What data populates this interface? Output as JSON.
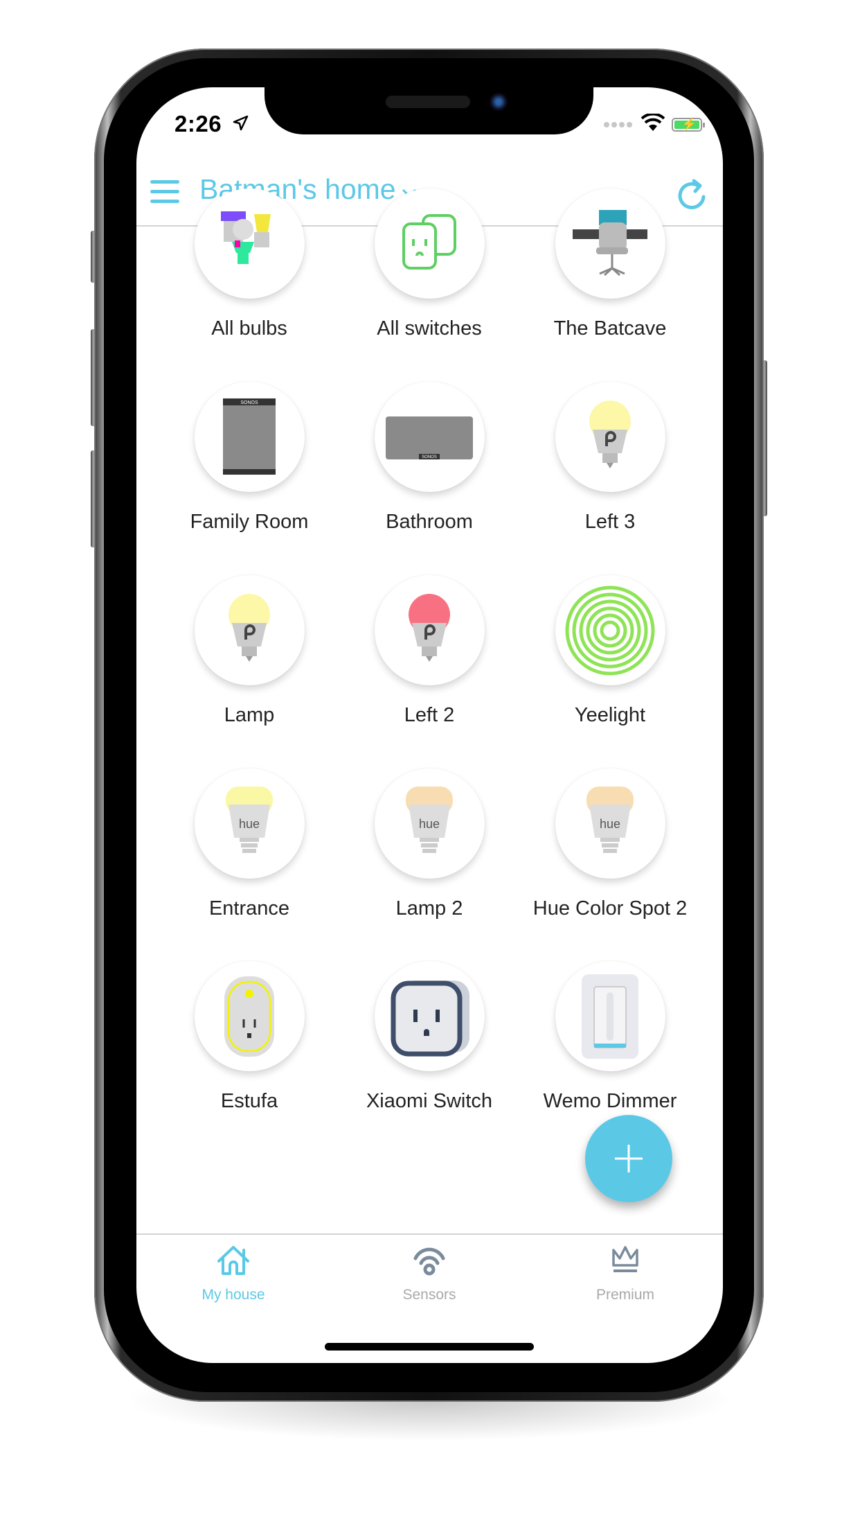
{
  "status_bar": {
    "time": "2:26",
    "location_icon": "location-arrow-icon",
    "battery_charging": true
  },
  "header": {
    "title": "Batman's home",
    "menu_icon": "hamburger-icon",
    "refresh_icon": "refresh-icon"
  },
  "colors": {
    "accent": "#5bc9e6",
    "inactive": "#7a8b9c",
    "label": "#222222"
  },
  "devices": [
    {
      "label": "All bulbs",
      "icon": "bulbs-group"
    },
    {
      "label": "All switches",
      "icon": "switches-group"
    },
    {
      "label": "The Batcave",
      "icon": "office-chair"
    },
    {
      "label": "Family Room",
      "icon": "sonos-tall"
    },
    {
      "label": "Bathroom",
      "icon": "sonos-wide"
    },
    {
      "label": "Left 3",
      "icon": "tplink-bulb",
      "color": "#fdf7a8"
    },
    {
      "label": "Lamp",
      "icon": "tplink-bulb",
      "color": "#fdf7a8"
    },
    {
      "label": "Left 2",
      "icon": "tplink-bulb",
      "color": "#f87182"
    },
    {
      "label": "Yeelight",
      "icon": "light-strip",
      "color": "#8fe356"
    },
    {
      "label": "Entrance",
      "icon": "hue-bulb",
      "color": "#fbf8a5"
    },
    {
      "label": "Lamp 2",
      "icon": "hue-bulb",
      "color": "#f9ddb2"
    },
    {
      "label": "Hue Color Spot 2",
      "icon": "hue-bulb",
      "color": "#f9ddb2"
    },
    {
      "label": "Estufa",
      "icon": "tplink-plug"
    },
    {
      "label": "Xiaomi Switch",
      "icon": "xiaomi-plug"
    },
    {
      "label": "Wemo Dimmer",
      "icon": "wemo-dimmer"
    }
  ],
  "hue_text": "hue",
  "sonos_text": "SONOS",
  "fab": {
    "icon": "plus-icon"
  },
  "tabs": [
    {
      "label": "My house",
      "icon": "house-icon",
      "active": true
    },
    {
      "label": "Sensors",
      "icon": "sensor-icon",
      "active": false
    },
    {
      "label": "Premium",
      "icon": "crown-icon",
      "active": false
    }
  ]
}
